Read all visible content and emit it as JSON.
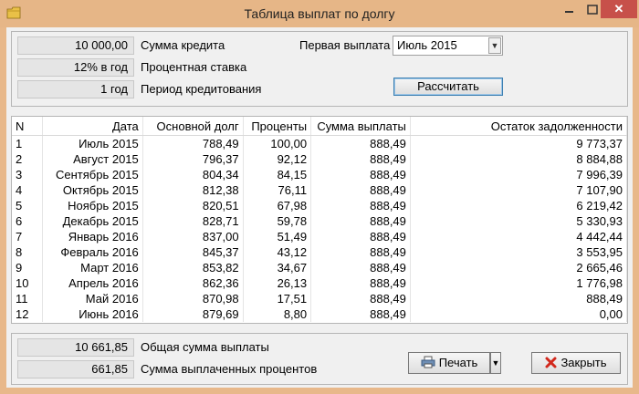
{
  "window": {
    "title": "Таблица выплат по долгу",
    "close_glyph": "✕"
  },
  "params": {
    "amount_value": "10 000,00",
    "amount_label": "Сумма кредита",
    "rate_value": "12% в год",
    "rate_label": "Процентная ставка",
    "period_value": "1 год",
    "period_label": "Период кредитования",
    "first_payment_label": "Первая выплата",
    "first_payment_value": "Июль 2015",
    "calculate_label": "Рассчитать"
  },
  "table": {
    "columns": [
      "N",
      "Дата",
      "Основной долг",
      "Проценты",
      "Сумма выплаты",
      "Остаток задолженности"
    ],
    "rows": [
      [
        "1",
        "Июль 2015",
        "788,49",
        "100,00",
        "888,49",
        "9 773,37"
      ],
      [
        "2",
        "Август 2015",
        "796,37",
        "92,12",
        "888,49",
        "8 884,88"
      ],
      [
        "3",
        "Сентябрь 2015",
        "804,34",
        "84,15",
        "888,49",
        "7 996,39"
      ],
      [
        "4",
        "Октябрь 2015",
        "812,38",
        "76,11",
        "888,49",
        "7 107,90"
      ],
      [
        "5",
        "Ноябрь 2015",
        "820,51",
        "67,98",
        "888,49",
        "6 219,42"
      ],
      [
        "6",
        "Декабрь 2015",
        "828,71",
        "59,78",
        "888,49",
        "5 330,93"
      ],
      [
        "7",
        "Январь 2016",
        "837,00",
        "51,49",
        "888,49",
        "4 442,44"
      ],
      [
        "8",
        "Февраль 2016",
        "845,37",
        "43,12",
        "888,49",
        "3 553,95"
      ],
      [
        "9",
        "Март 2016",
        "853,82",
        "34,67",
        "888,49",
        "2 665,46"
      ],
      [
        "10",
        "Апрель 2016",
        "862,36",
        "26,13",
        "888,49",
        "1 776,98"
      ],
      [
        "11",
        "Май 2016",
        "870,98",
        "17,51",
        "888,49",
        "888,49"
      ],
      [
        "12",
        "Июнь 2016",
        "879,69",
        "8,80",
        "888,49",
        "0,00"
      ]
    ]
  },
  "totals": {
    "total_value": "10 661,85",
    "total_label": "Общая сумма выплаты",
    "interest_value": "661,85",
    "interest_label": "Сумма выплаченных процентов"
  },
  "footer": {
    "print_label": "Печать",
    "close_label": "Закрыть"
  },
  "colors": {
    "frame": "#e8b88a",
    "close_button": "#c7504a"
  }
}
